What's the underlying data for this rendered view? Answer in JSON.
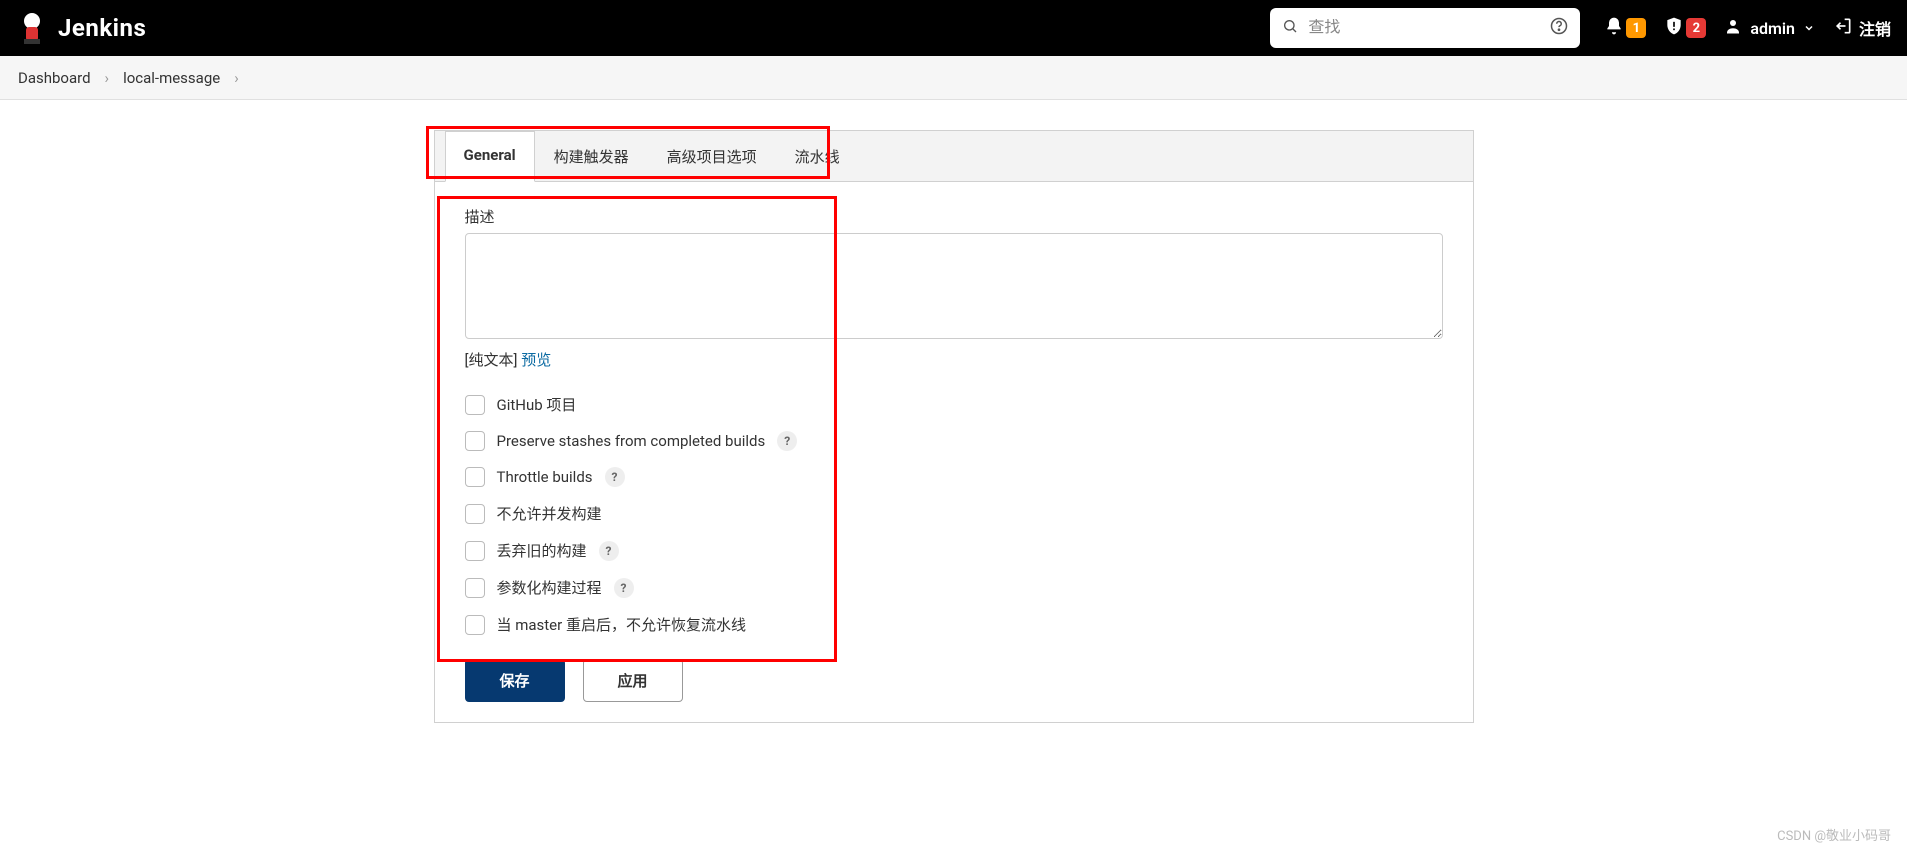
{
  "header": {
    "logo_text": "Jenkins",
    "search_placeholder": "查找",
    "notif_count": "1",
    "alert_count": "2",
    "username": "admin",
    "logout_label": "注销"
  },
  "breadcrumbs": {
    "items": [
      "Dashboard",
      "local-message"
    ]
  },
  "tabs": {
    "items": [
      "General",
      "构建触发器",
      "高级项目选项",
      "流水线"
    ],
    "active": 0
  },
  "form": {
    "desc_label": "描述",
    "desc_value": "",
    "hint_plain": "[纯文本]",
    "hint_link": "预览",
    "checks": [
      {
        "label": "GitHub 项目",
        "help": false
      },
      {
        "label": "Preserve stashes from completed builds",
        "help": true
      },
      {
        "label": "Throttle builds",
        "help": true
      },
      {
        "label": "不允许并发构建",
        "help": false
      },
      {
        "label": "丢弃旧的构建",
        "help": true
      },
      {
        "label": "参数化构建过程",
        "help": true
      },
      {
        "label": "当 master 重启后，不允许恢复流水线",
        "help": false
      }
    ]
  },
  "buttons": {
    "save": "保存",
    "apply": "应用"
  },
  "watermark": "CSDN @敬业小码哥"
}
